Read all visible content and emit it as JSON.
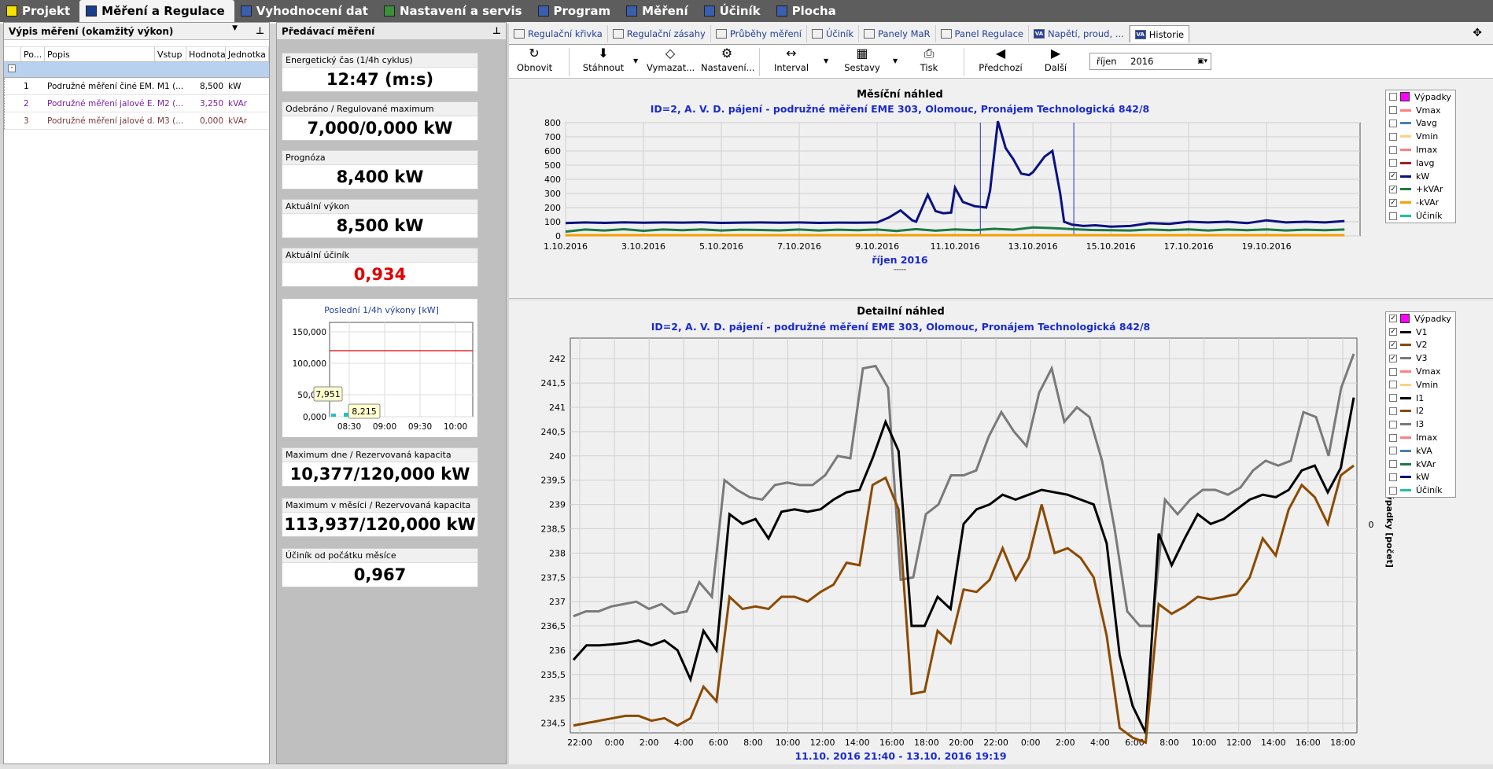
{
  "top_tabs": [
    {
      "label": "Projekt",
      "icon": "folder-icon",
      "color": "#f5e200"
    },
    {
      "label": "Měření a Regulace",
      "icon": "mar-icon",
      "color": "#1c3f8a",
      "active": true
    },
    {
      "label": "Vyhodnocení dat",
      "icon": "table-icon",
      "color": "#3a5fb0"
    },
    {
      "label": "Nastavení a servis",
      "icon": "tools-icon",
      "color": "#3b8f3b"
    },
    {
      "label": "Program",
      "icon": "bars-icon",
      "color": "#3a5fb0"
    },
    {
      "label": "Měření",
      "icon": "grid-icon",
      "color": "#3a5fb0"
    },
    {
      "label": "Účiník",
      "icon": "grid-icon",
      "color": "#3a5fb0"
    },
    {
      "label": "Plocha",
      "icon": "grid-icon",
      "color": "#3a5fb0"
    }
  ],
  "left_panel": {
    "title": "Výpis měření (okamžitý výkon)",
    "columns": [
      "Po...",
      "Popis",
      "Vstup",
      "Hodnota",
      "Jednotka"
    ],
    "rows": [
      {
        "no": "1",
        "desc": "Podružné měření činé EM...",
        "input": "M1 (...",
        "value": "8,500",
        "unit": "kW",
        "color": "#000000"
      },
      {
        "no": "2",
        "desc": "Podružné měření jalové E...",
        "input": "M2 (...",
        "value": "3,250",
        "unit": "kVAr",
        "color": "#7a1fa6"
      },
      {
        "no": "3",
        "desc": "Podružné měření jalové d...",
        "input": "M3 (...",
        "value": "0,000",
        "unit": "kVAr",
        "color": "#7a3a3a"
      }
    ]
  },
  "mid_panel": {
    "title": "Předávací měření",
    "cards": [
      {
        "label": "Energetický čas (1/4h cyklus)",
        "value": "12:47 (m:s)",
        "color": "#000000"
      },
      {
        "label": "Odebráno / Regulované maximum",
        "value": "7,000/0,000 kW",
        "color": "#000000"
      },
      {
        "label": "Prognóza",
        "value": "8,400 kW",
        "color": "#000000"
      },
      {
        "label": "Aktuální výkon",
        "value": "8,500 kW",
        "color": "#000000"
      },
      {
        "label": "Aktuální účiník",
        "value": "0,934",
        "color": "#e00000"
      }
    ],
    "cards2": [
      {
        "label": "Maximum dne / Rezervovaná kapacita",
        "value": "10,377/120,000 kW"
      },
      {
        "label": "Maximum v měsíci / Rezervovaná kapacita",
        "value": "113,937/120,000 kW"
      },
      {
        "label": "Účiník od počátku měsíce",
        "value": "0,967"
      }
    ],
    "mini_chart": {
      "title": "Poslední 1/4h výkony [kW]",
      "yticks": [
        "150,000",
        "100,000",
        "50,000",
        "0,000"
      ],
      "xticks": [
        "08:30",
        "09:00",
        "09:30",
        "10:00"
      ],
      "tooltips": [
        "7,951",
        "8,215"
      ]
    }
  },
  "right_tabs": [
    {
      "label": "Regulační křivka"
    },
    {
      "label": "Regulační zásahy"
    },
    {
      "label": "Průběhy měření"
    },
    {
      "label": "Účiník"
    },
    {
      "label": "Panely MaR"
    },
    {
      "label": "Panel Regulace"
    },
    {
      "label": "Napětí, proud, ..."
    },
    {
      "label": "Historie",
      "active": true
    }
  ],
  "toolbar": {
    "refresh": "Obnovit",
    "download": "Stáhnout",
    "erase": "Vymazat...",
    "settings": "Nastavení...",
    "interval": "Interval",
    "reports": "Sestavy",
    "print": "Tisk",
    "prev": "Předchozí",
    "next": "Další",
    "month": "říjen",
    "year": "2016"
  },
  "chart_data": [
    {
      "type": "line",
      "title": "Měsíční náhled",
      "subtitle": "ID=2, A. V. D. pájení - podružné měření EME 303, Olomouc, Pronájem Technologická 842/8",
      "xlabel": "říjen 2016",
      "x_ticks": [
        "1.10.2016",
        "3.10.2016",
        "5.10.2016",
        "7.10.2016",
        "9.10.2016",
        "11.10.2016",
        "13.10.2016",
        "15.10.2016",
        "17.10.2016",
        "19.10.2016"
      ],
      "ylim": [
        0,
        800
      ],
      "y_ticks": [
        0,
        100,
        200,
        300,
        400,
        500,
        600,
        700,
        800
      ],
      "legend": [
        {
          "name": "Výpadky",
          "color": "#ff00ff",
          "checked": false,
          "box": true
        },
        {
          "name": "Vmax",
          "color": "#ff8080",
          "checked": false
        },
        {
          "name": "Vavg",
          "color": "#4a7fb5",
          "checked": false
        },
        {
          "name": "Vmin",
          "color": "#ffd080",
          "checked": false
        },
        {
          "name": "Imax",
          "color": "#ff8080",
          "checked": false
        },
        {
          "name": "Iavg",
          "color": "#a02020",
          "checked": false
        },
        {
          "name": "kW",
          "color": "#0b1280",
          "checked": true
        },
        {
          "name": "+kVAr",
          "color": "#1d7a45",
          "checked": true
        },
        {
          "name": "-kVAr",
          "color": "#f5a000",
          "checked": true
        },
        {
          "name": "Účiník",
          "color": "#20c0a0",
          "checked": false
        }
      ],
      "series": [
        {
          "name": "kW",
          "color": "#0b1280",
          "x_days": [
            1,
            1.5,
            2,
            2.5,
            3,
            3.5,
            4,
            4.5,
            5,
            5.5,
            6,
            6.5,
            7,
            7.5,
            8,
            8.5,
            9,
            9.3,
            9.6,
            9.9,
            10.0,
            10.3,
            10.5,
            10.7,
            10.9,
            11.0,
            11.2,
            11.5,
            11.8,
            11.9,
            12.1,
            12.3,
            12.5,
            12.7,
            12.9,
            13.0,
            13.3,
            13.5,
            13.7,
            13.8,
            14.0,
            14.3,
            14.6,
            15,
            15.5,
            16,
            16.5,
            17,
            17.5,
            18,
            18.5,
            19,
            19.5,
            20,
            20.5,
            21
          ],
          "values": [
            90,
            95,
            92,
            96,
            93,
            95,
            94,
            96,
            92,
            94,
            95,
            93,
            95,
            92,
            94,
            93,
            95,
            130,
            180,
            110,
            100,
            290,
            175,
            160,
            165,
            340,
            240,
            210,
            200,
            320,
            810,
            620,
            540,
            440,
            430,
            450,
            560,
            600,
            300,
            100,
            80,
            70,
            75,
            65,
            70,
            90,
            85,
            100,
            95,
            100,
            90,
            110,
            95,
            100,
            95,
            105
          ]
        },
        {
          "name": "+kVAr",
          "color": "#1d7a45",
          "x_days": [
            1,
            1.5,
            2,
            2.5,
            3,
            3.5,
            4,
            4.5,
            5,
            5.5,
            6,
            6.5,
            7,
            7.5,
            8,
            8.5,
            9,
            9.5,
            10,
            10.5,
            11,
            11.5,
            12,
            12.5,
            13,
            13.5,
            14,
            14.5,
            15,
            15.5,
            16,
            16.5,
            17,
            17.5,
            18,
            18.5,
            19,
            19.5,
            20,
            20.5,
            21
          ],
          "values": [
            30,
            45,
            38,
            47,
            36,
            45,
            40,
            46,
            38,
            44,
            42,
            39,
            45,
            38,
            44,
            40,
            45,
            35,
            48,
            37,
            46,
            40,
            50,
            44,
            60,
            55,
            48,
            42,
            40,
            38,
            45,
            40,
            46,
            38,
            45,
            40,
            46,
            38,
            44,
            40,
            45
          ]
        },
        {
          "name": "-kVAr",
          "color": "#f5a000",
          "x_days": [
            1,
            21
          ],
          "values": [
            5,
            5
          ]
        }
      ]
    },
    {
      "type": "line",
      "title": "Detailní náhled",
      "subtitle": "ID=2, A. V. D. pájení - podružné měření EME 303, Olomouc, Pronájem Technologická 842/8",
      "xlabel": "11.10. 2016 21:40 - 13.10. 2016 19:19",
      "y2label": "Výpadky [počet]",
      "y2_ticks": [
        "0"
      ],
      "x_ticks": [
        "22:00",
        "0:00",
        "2:00",
        "4:00",
        "6:00",
        "8:00",
        "10:00",
        "12:00",
        "14:00",
        "16:00",
        "18:00",
        "20:00",
        "22:00",
        "0:00",
        "2:00",
        "4:00",
        "6:00",
        "8:00",
        "10:00",
        "12:00",
        "14:00",
        "16:00",
        "18:00"
      ],
      "ylim": [
        234.3,
        242.1
      ],
      "y_ticks": [
        "234,5",
        "235",
        "235,5",
        "236",
        "236,5",
        "237",
        "237,5",
        "238",
        "238,5",
        "239",
        "239,5",
        "240",
        "240,5",
        "241",
        "241,5",
        "242"
      ],
      "legend": [
        {
          "name": "Výpadky",
          "color": "#ff00ff",
          "checked": true,
          "box": true
        },
        {
          "name": "V1",
          "color": "#000000",
          "checked": true
        },
        {
          "name": "V2",
          "color": "#8b4a00",
          "checked": true
        },
        {
          "name": "V3",
          "color": "#7a7a7a",
          "checked": true
        },
        {
          "name": "Vmax",
          "color": "#ff8080",
          "checked": false
        },
        {
          "name": "Vmin",
          "color": "#ffd080",
          "checked": false
        },
        {
          "name": "I1",
          "color": "#000000",
          "checked": false
        },
        {
          "name": "I2",
          "color": "#8b4a00",
          "checked": false
        },
        {
          "name": "I3",
          "color": "#7a7a7a",
          "checked": false
        },
        {
          "name": "Imax",
          "color": "#ff8080",
          "checked": false
        },
        {
          "name": "kVA",
          "color": "#4a7fb5",
          "checked": false
        },
        {
          "name": "kVAr",
          "color": "#1d7a45",
          "checked": false
        },
        {
          "name": "kW",
          "color": "#0b1280",
          "checked": false
        },
        {
          "name": "Účiník",
          "color": "#20c0a0",
          "checked": false
        }
      ],
      "series": [
        {
          "name": "V3",
          "color": "#7a7a7a",
          "values": [
            236.7,
            236.8,
            236.8,
            236.9,
            236.95,
            237.0,
            236.85,
            236.95,
            236.75,
            236.8,
            237.4,
            237.1,
            239.5,
            239.3,
            239.15,
            239.1,
            239.4,
            239.45,
            239.4,
            239.4,
            239.6,
            240.0,
            239.95,
            241.8,
            241.85,
            241.4,
            237.45,
            237.5,
            238.8,
            239.0,
            239.6,
            239.6,
            239.7,
            240.4,
            240.9,
            240.5,
            240.2,
            241.3,
            241.8,
            240.7,
            241.0,
            240.8,
            239.9,
            238.5,
            236.8,
            236.5,
            236.5,
            239.1,
            238.8,
            239.1,
            239.3,
            239.3,
            239.2,
            239.35,
            239.7,
            239.9,
            239.8,
            239.9,
            240.9,
            240.8,
            240.0,
            241.4,
            242.1
          ]
        },
        {
          "name": "V1",
          "color": "#000000",
          "values": [
            235.8,
            236.1,
            236.1,
            236.12,
            236.15,
            236.2,
            236.1,
            236.2,
            236.0,
            235.4,
            236.4,
            236.0,
            238.8,
            238.6,
            238.7,
            238.3,
            238.85,
            238.9,
            238.85,
            238.9,
            239.1,
            239.25,
            239.3,
            239.95,
            240.7,
            240.1,
            236.5,
            236.5,
            237.1,
            236.85,
            238.6,
            238.9,
            239.0,
            239.2,
            239.1,
            239.2,
            239.3,
            239.25,
            239.2,
            239.1,
            239.0,
            238.2,
            235.9,
            234.85,
            234.3,
            238.4,
            237.75,
            238.3,
            238.8,
            238.6,
            238.7,
            238.9,
            239.1,
            239.2,
            239.15,
            239.3,
            239.7,
            239.8,
            239.25,
            239.75,
            241.2
          ]
        },
        {
          "name": "V2",
          "color": "#8b4a00",
          "values": [
            234.45,
            234.5,
            234.55,
            234.6,
            234.65,
            234.65,
            234.55,
            234.6,
            234.45,
            234.6,
            235.25,
            234.95,
            237.1,
            236.85,
            236.9,
            236.85,
            237.1,
            237.1,
            237.0,
            237.2,
            237.35,
            237.8,
            237.75,
            239.4,
            239.55,
            238.9,
            235.1,
            235.15,
            236.4,
            236.15,
            237.25,
            237.2,
            237.45,
            238.1,
            237.45,
            237.9,
            239.0,
            238.0,
            238.1,
            237.9,
            237.5,
            236.3,
            234.4,
            234.2,
            234.1,
            236.95,
            236.75,
            236.9,
            237.1,
            237.05,
            237.1,
            237.15,
            237.5,
            238.3,
            237.95,
            238.9,
            239.4,
            239.15,
            238.6,
            239.6,
            239.8
          ]
        }
      ]
    }
  ]
}
